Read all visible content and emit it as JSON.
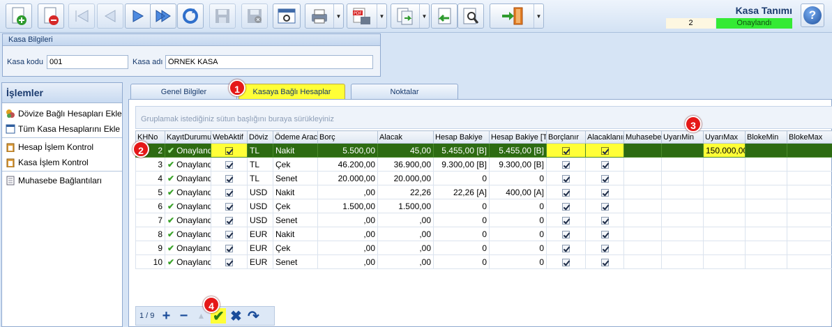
{
  "window": {
    "title": "Kasa Tanımı",
    "record_count": "2",
    "status": "Onaylandı",
    "status_color": "#34ea34"
  },
  "toolbar": {
    "buttons": [
      {
        "name": "new-record",
        "icon": "add-document-icon"
      },
      {
        "name": "delete-record",
        "icon": "delete-document-icon"
      },
      {
        "name": "first-record",
        "icon": "first-arrow-icon"
      },
      {
        "name": "prev-record",
        "icon": "prev-arrow-icon"
      },
      {
        "name": "next-record",
        "icon": "next-arrow-icon"
      },
      {
        "name": "last-record",
        "icon": "last-arrow-icon"
      },
      {
        "name": "refresh",
        "icon": "refresh-icon"
      },
      {
        "name": "save",
        "icon": "save-icon"
      },
      {
        "name": "cancel-save",
        "icon": "save-cancel-icon"
      },
      {
        "name": "preview",
        "icon": "preview-window-icon"
      },
      {
        "name": "print",
        "icon": "printer-icon"
      },
      {
        "name": "export-pdf",
        "icon": "pdf-icon",
        "badge": "PDF"
      },
      {
        "name": "copy",
        "icon": "copy-documents-icon"
      },
      {
        "name": "import",
        "icon": "import-document-icon"
      },
      {
        "name": "search",
        "icon": "search-document-icon"
      },
      {
        "name": "exit",
        "icon": "exit-door-icon"
      }
    ],
    "help_label": "?"
  },
  "kasa_bilgileri": {
    "header": "Kasa Bilgileri",
    "kod_label": "Kasa kodu",
    "kod_value": "001",
    "ad_label": "Kasa adı",
    "ad_value": "ÖRNEK KASA"
  },
  "sidebar": {
    "title": "İşlemler",
    "items": [
      {
        "label": "Dövize Bağlı Hesapları Ekle",
        "icon": "coins-icon"
      },
      {
        "label": "Tüm Kasa Hesaplarını Ekle",
        "icon": "window-list-icon"
      },
      {
        "label": "Hesap İşlem Kontrol",
        "icon": "clipboard-icon"
      },
      {
        "label": "Kasa İşlem Kontrol",
        "icon": "clipboard-icon"
      },
      {
        "label": "Muhasebe Bağlantıları",
        "icon": "ledger-icon"
      }
    ]
  },
  "tabs": [
    {
      "label": "Genel Bilgiler",
      "active": false
    },
    {
      "label": "Kasaya Bağlı Hesaplar",
      "active": true
    },
    {
      "label": "Noktalar",
      "active": false
    }
  ],
  "grid": {
    "group_hint": "Gruplamak istediğiniz sütun başlığını buraya sürükleyiniz",
    "columns": [
      "KHNo",
      "KayıtDurumu",
      "WebAktif",
      "Döviz",
      "Ödeme Aracı",
      "Borç",
      "Alacak",
      "Hesap Bakiye",
      "Hesap Bakiye [T",
      "Borçlanır",
      "Alacaklanır",
      "Muhasebe",
      "UyarıMin",
      "UyarıMax",
      "BlokeMin",
      "BlokeMax"
    ],
    "rows": [
      {
        "no": "2",
        "durum": "Onaylandı",
        "doviz": "TL",
        "arac": "Nakit",
        "borc": "5.500,00",
        "alacak": "45,00",
        "bakiye": "5.455,00 [B]",
        "bakiyet": "5.455,00 [B]",
        "uyarimax": "150.000,00"
      },
      {
        "no": "3",
        "durum": "Onaylandı",
        "doviz": "TL",
        "arac": "Çek",
        "borc": "46.200,00",
        "alacak": "36.900,00",
        "bakiye": "9.300,00 [B]",
        "bakiyet": "9.300,00 [B]",
        "uyarimax": ""
      },
      {
        "no": "4",
        "durum": "Onaylandı",
        "doviz": "TL",
        "arac": "Senet",
        "borc": "20.000,00",
        "alacak": "20.000,00",
        "bakiye": "0",
        "bakiyet": "0",
        "uyarimax": ""
      },
      {
        "no": "5",
        "durum": "Onaylandı",
        "doviz": "USD",
        "arac": "Nakit",
        "borc": ",00",
        "alacak": "22,26",
        "bakiye": "22,26 [A]",
        "bakiyet": "400,00 [A]",
        "uyarimax": ""
      },
      {
        "no": "6",
        "durum": "Onaylandı",
        "doviz": "USD",
        "arac": "Çek",
        "borc": "1.500,00",
        "alacak": "1.500,00",
        "bakiye": "0",
        "bakiyet": "0",
        "uyarimax": ""
      },
      {
        "no": "7",
        "durum": "Onaylandı",
        "doviz": "USD",
        "arac": "Senet",
        "borc": ",00",
        "alacak": ",00",
        "bakiye": "0",
        "bakiyet": "0",
        "uyarimax": ""
      },
      {
        "no": "8",
        "durum": "Onaylandı",
        "doviz": "EUR",
        "arac": "Nakit",
        "borc": ",00",
        "alacak": ",00",
        "bakiye": "0",
        "bakiyet": "0",
        "uyarimax": ""
      },
      {
        "no": "9",
        "durum": "Onaylandı",
        "doviz": "EUR",
        "arac": "Çek",
        "borc": ",00",
        "alacak": ",00",
        "bakiye": "0",
        "bakiyet": "0",
        "uyarimax": ""
      },
      {
        "no": "10",
        "durum": "Onaylandı",
        "doviz": "EUR",
        "arac": "Senet",
        "borc": ",00",
        "alacak": ",00",
        "bakiye": "0",
        "bakiyet": "0",
        "uyarimax": ""
      }
    ]
  },
  "footer": {
    "page": "1 / 9",
    "icons": [
      "plus-icon",
      "minus-icon",
      "up-arrow-icon",
      "check-icon",
      "cross-icon",
      "redo-icon"
    ]
  },
  "callouts": [
    "1",
    "2",
    "3",
    "4"
  ]
}
